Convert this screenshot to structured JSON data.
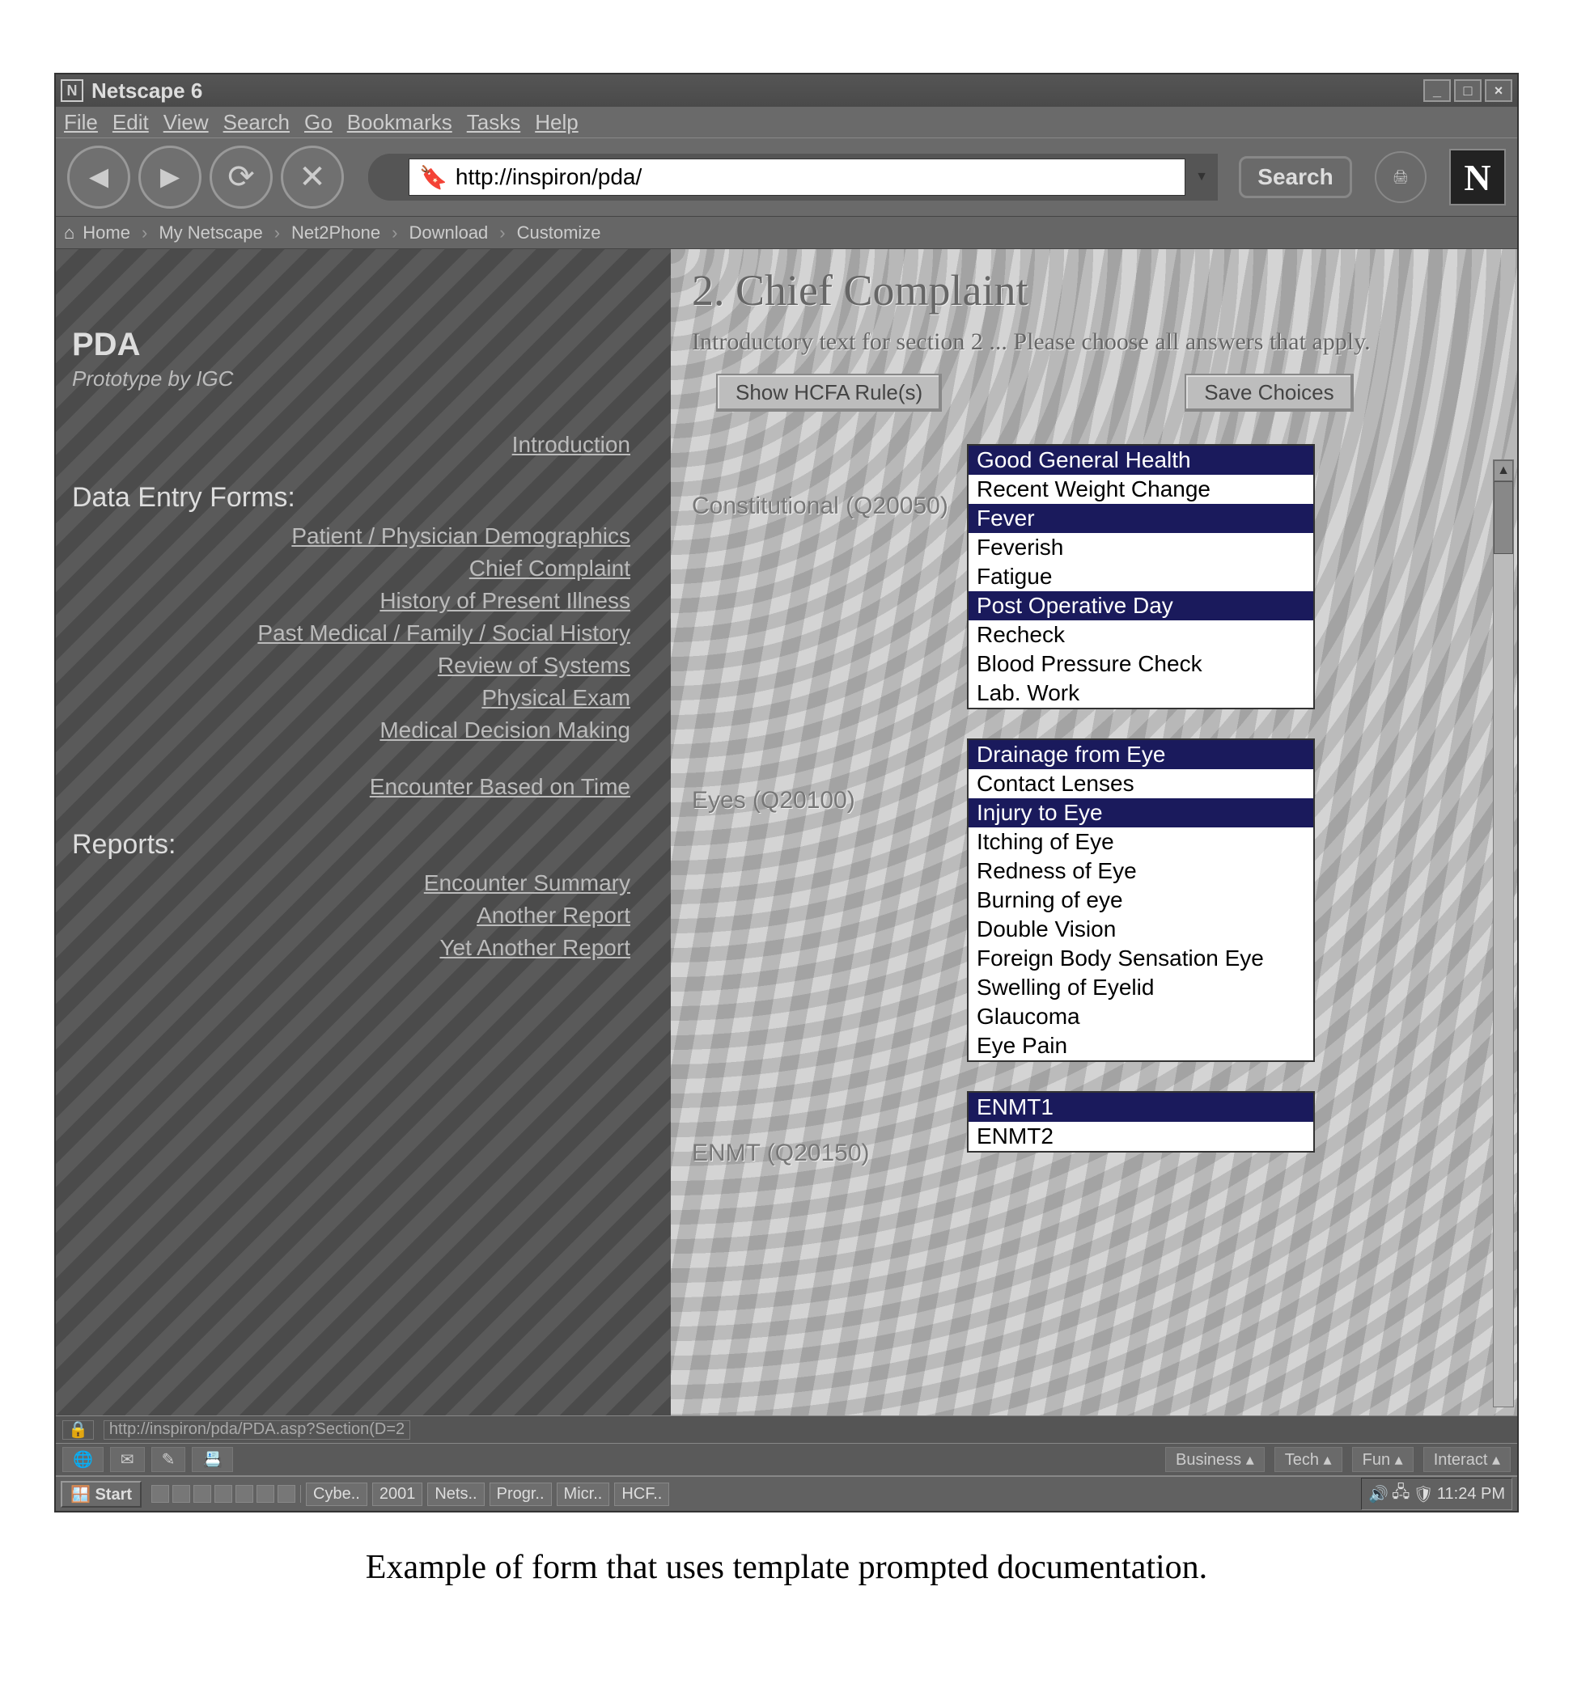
{
  "window": {
    "title": "Netscape 6"
  },
  "menubar": [
    "File",
    "Edit",
    "View",
    "Search",
    "Go",
    "Bookmarks",
    "Tasks",
    "Help"
  ],
  "nav": {
    "url": "http://inspiron/pda/",
    "search_label": "Search"
  },
  "personal_toolbar": [
    "Home",
    "My Netscape",
    "Net2Phone",
    "Download",
    "Customize"
  ],
  "sidebar": {
    "app_title": "PDA",
    "app_subtitle": "Prototype by IGC",
    "intro_link": "Introduction",
    "forms_heading": "Data Entry Forms:",
    "forms_links": [
      "Patient / Physician Demographics",
      "Chief Complaint",
      "History of Present Illness",
      "Past Medical / Family / Social History",
      "Review of Systems",
      "Physical Exam",
      "Medical Decision Making",
      "Encounter Based on Time"
    ],
    "reports_heading": "Reports:",
    "reports_links": [
      "Encounter Summary",
      "Another Report",
      "Yet Another Report"
    ]
  },
  "main": {
    "heading": "2.   Chief Complaint",
    "intro": "Introductory text for section 2 ... Please choose all answers that apply.",
    "btn_hcfa": "Show HCFA Rule(s)",
    "btn_save": "Save Choices",
    "questions": [
      {
        "label": "Constitutional (Q20050)",
        "options": [
          {
            "text": "Good General Health",
            "selected": true
          },
          {
            "text": "Recent Weight Change",
            "selected": false
          },
          {
            "text": "Fever",
            "selected": true
          },
          {
            "text": "Feverish",
            "selected": false
          },
          {
            "text": "Fatigue",
            "selected": false
          },
          {
            "text": "Post Operative Day",
            "selected": true
          },
          {
            "text": "Recheck",
            "selected": false
          },
          {
            "text": "Blood Pressure Check",
            "selected": false
          },
          {
            "text": "Lab. Work",
            "selected": false
          }
        ]
      },
      {
        "label": "Eyes (Q20100)",
        "options": [
          {
            "text": "Drainage from Eye",
            "selected": true
          },
          {
            "text": "Contact Lenses",
            "selected": false
          },
          {
            "text": "Injury to Eye",
            "selected": true
          },
          {
            "text": "Itching of Eye",
            "selected": false
          },
          {
            "text": "Redness of Eye",
            "selected": false
          },
          {
            "text": "Burning of eye",
            "selected": false
          },
          {
            "text": "Double Vision",
            "selected": false
          },
          {
            "text": "Foreign Body Sensation Eye",
            "selected": false
          },
          {
            "text": "Swelling of Eyelid",
            "selected": false
          },
          {
            "text": "Glaucoma",
            "selected": false
          },
          {
            "text": "Eye Pain",
            "selected": false
          }
        ]
      },
      {
        "label": "ENMT (Q20150)",
        "options": [
          {
            "text": "ENMT1",
            "selected": true
          },
          {
            "text": "ENMT2",
            "selected": false
          }
        ]
      }
    ]
  },
  "statusbar": {
    "text": "http://inspiron/pda/PDA.asp?Section(D=2"
  },
  "tabbar": {
    "left": [],
    "right": [
      "Business",
      "Tech",
      "Fun",
      "Interact"
    ]
  },
  "taskbar": {
    "start": "Start",
    "buttons": [
      "Cybe..",
      "2001",
      "Nets..",
      "Progr..",
      "Micr..",
      "HCF.."
    ],
    "clock": "11:24 PM"
  },
  "caption": "Example of form that uses template prompted documentation."
}
